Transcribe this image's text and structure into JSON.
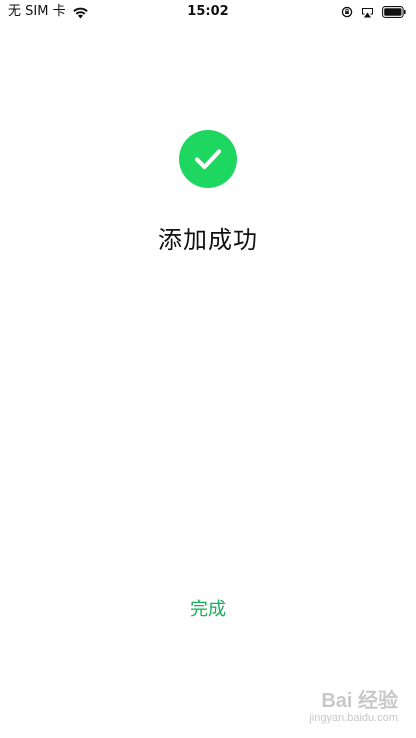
{
  "status_bar": {
    "carrier": "无 SIM 卡",
    "time": "15:02",
    "icons": [
      "wifi-icon",
      "lock-rotation-icon",
      "airplay-icon",
      "battery-icon"
    ]
  },
  "main": {
    "icon": "checkmark-icon",
    "title": "添加成功"
  },
  "footer": {
    "done_label": "完成"
  },
  "watermark": {
    "brand": "Bai 经验",
    "url": "jingyan.baidu.com"
  },
  "colors": {
    "success_green": "#1ed760",
    "button_green": "#1aad5a",
    "text": "#111111"
  }
}
